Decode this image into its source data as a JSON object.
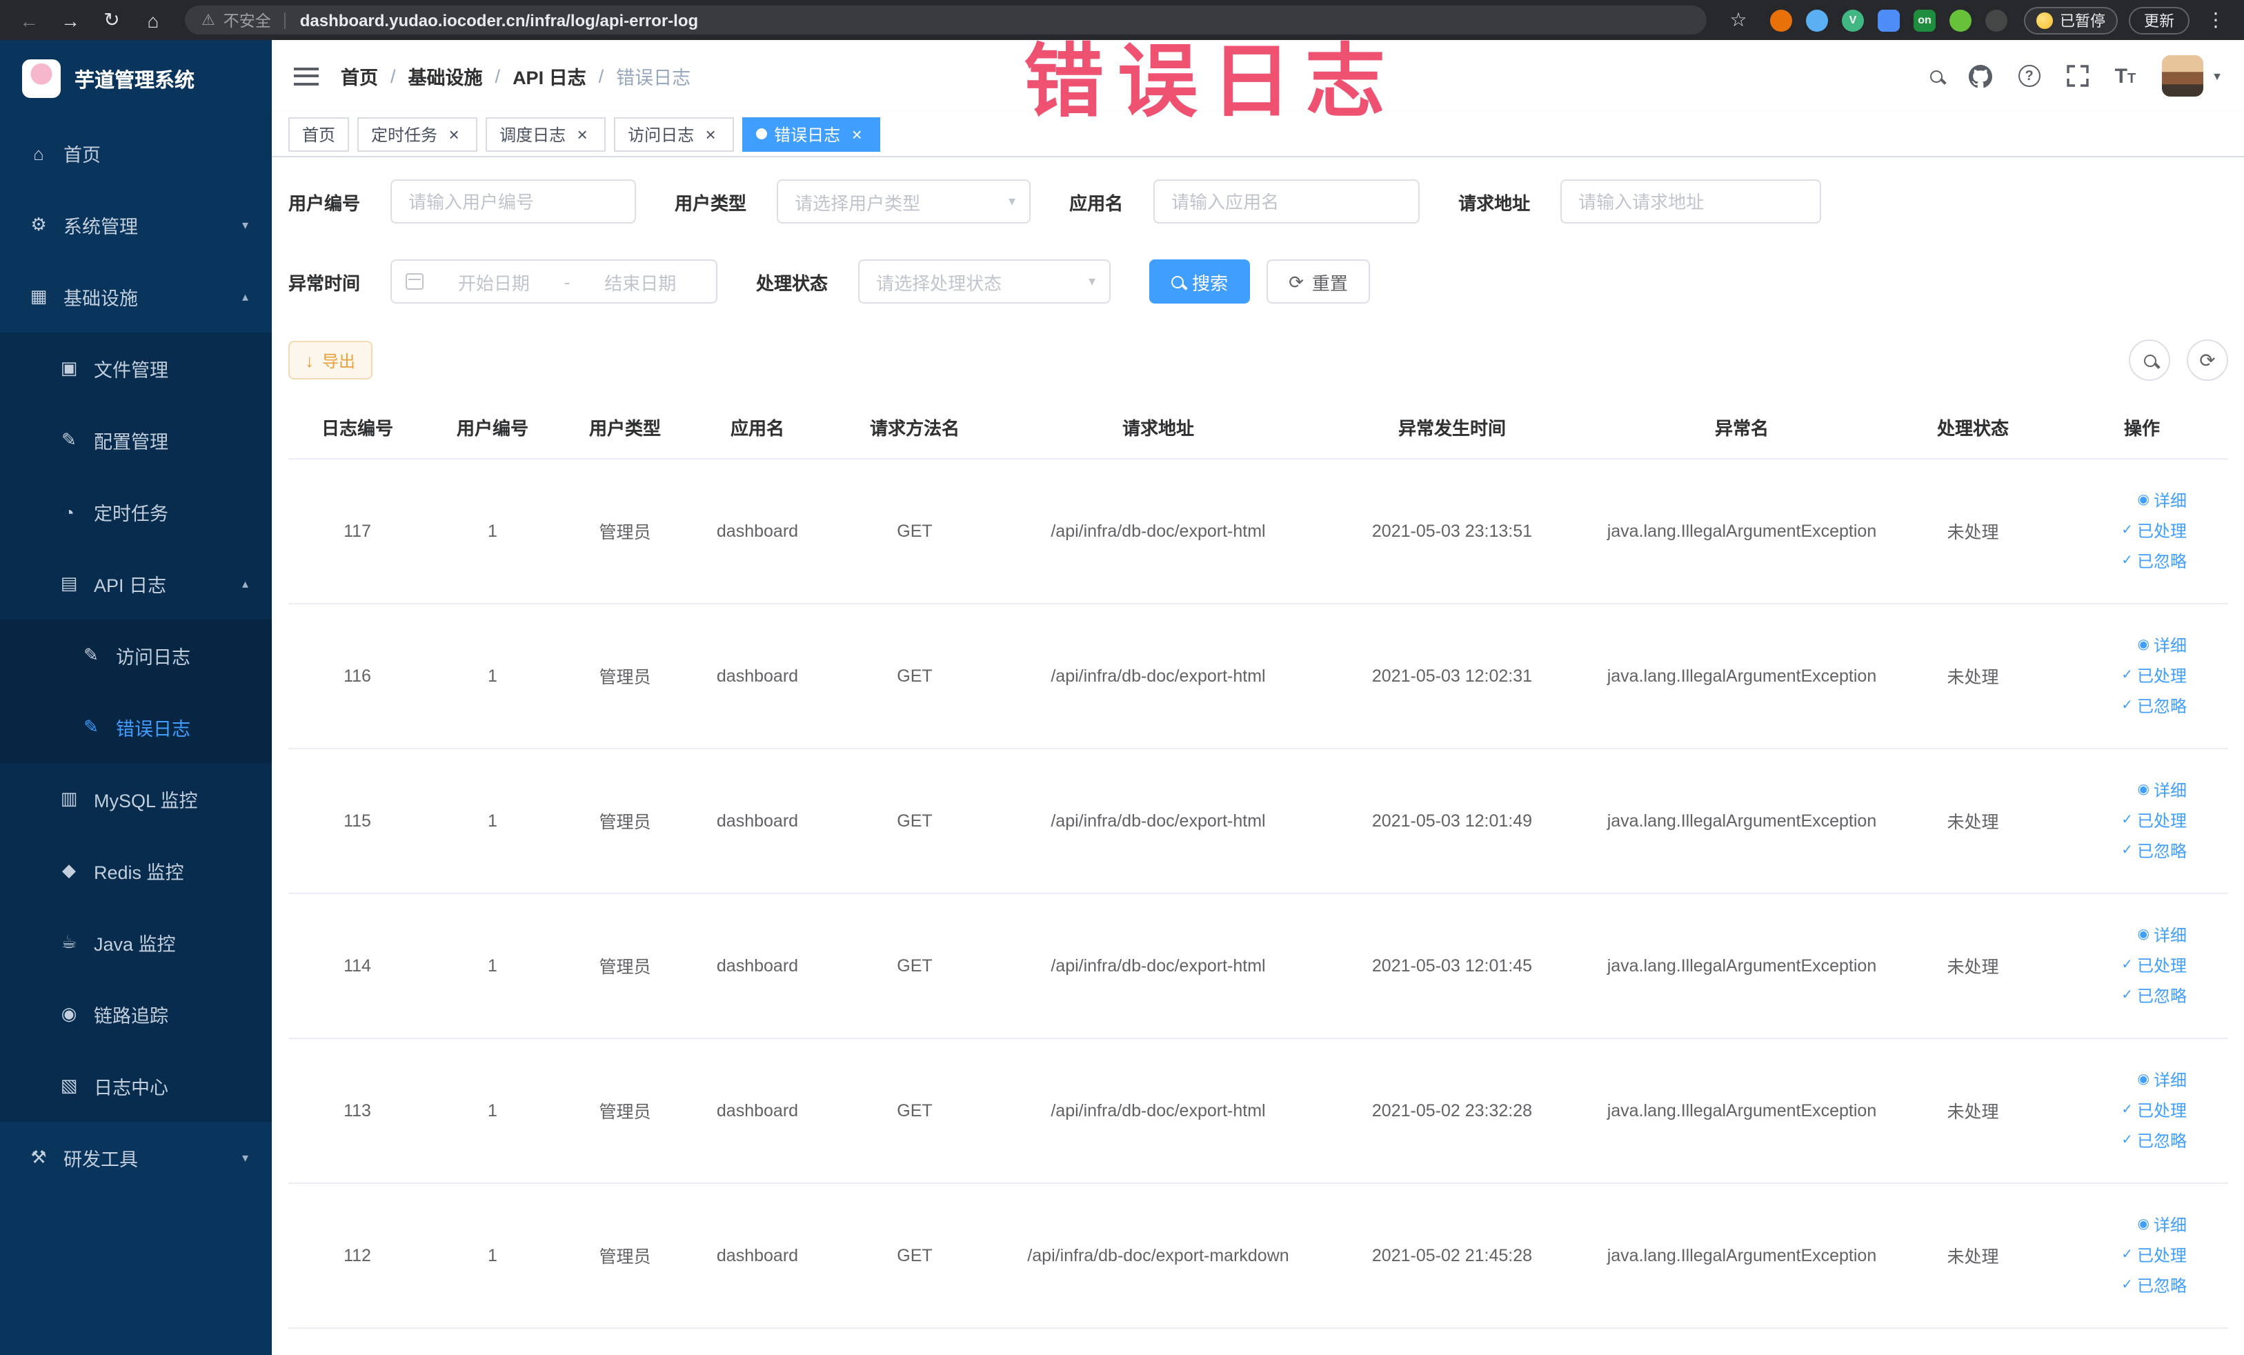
{
  "icons": {
    "back": "←",
    "forward": "→",
    "reload": "↻",
    "home": "⌂",
    "warning": "⚠",
    "star": "☆",
    "menu_dots": "⋮",
    "chevron_down": "▾",
    "chevron_up": "▴",
    "caret_down": "▼",
    "close": "×",
    "refresh": "⟳",
    "download": "↓",
    "question": "?",
    "fontsize_big": "T",
    "fontsize_small": "T"
  },
  "overlay": {
    "text": "错误日志"
  },
  "browser": {
    "security_label": "不安全",
    "url": "dashboard.yudao.iocoder.cn/infra/log/api-error-log",
    "paused_badge": "已暂停",
    "update_button": "更新",
    "extensions": [
      {
        "key": "orange",
        "color": "#e8710a",
        "shape": "circle",
        "glyph": ""
      },
      {
        "key": "blue",
        "color": "#5ab0f2",
        "shape": "circle",
        "glyph": ""
      },
      {
        "key": "vue-devtools",
        "color": "#41b883",
        "shape": "circle",
        "glyph": "V"
      },
      {
        "key": "grid",
        "color": "#4e8cf7",
        "shape": "square",
        "glyph": ""
      },
      {
        "key": "proxy-on",
        "color": "#1e8e3e",
        "shape": "square",
        "glyph": "on"
      },
      {
        "key": "green",
        "color": "#67c23a",
        "shape": "circle",
        "glyph": ""
      },
      {
        "key": "dark",
        "color": "#444746",
        "shape": "circle",
        "glyph": ""
      }
    ]
  },
  "sidebar": {
    "logo_title": "芋道管理系统",
    "items": [
      {
        "key": "home",
        "label": "首页",
        "icon": "home-icon",
        "glyph": "⌂",
        "depth": 0
      },
      {
        "key": "system",
        "label": "系统管理",
        "icon": "gear-icon",
        "glyph": "⚙",
        "depth": 0,
        "arrow": "down"
      },
      {
        "key": "infra",
        "label": "基础设施",
        "icon": "infra-icon",
        "glyph": "▦",
        "depth": 0,
        "arrow": "up"
      },
      {
        "key": "file",
        "label": "文件管理",
        "icon": "file-icon",
        "glyph": "▣",
        "depth": 1
      },
      {
        "key": "config",
        "label": "配置管理",
        "icon": "config-icon",
        "glyph": "✎",
        "depth": 1
      },
      {
        "key": "job",
        "label": "定时任务",
        "icon": "timer-icon",
        "glyph": "◔",
        "depth": 1
      },
      {
        "key": "api-log",
        "label": "API 日志",
        "icon": "api-log-icon",
        "glyph": "▤",
        "depth": 1,
        "arrow": "up"
      },
      {
        "key": "access-log",
        "label": "访问日志",
        "icon": "access-log-icon",
        "glyph": "✎",
        "depth": 2
      },
      {
        "key": "error-log",
        "label": "错误日志",
        "icon": "error-log-icon",
        "glyph": "✎",
        "depth": 2,
        "active": true
      },
      {
        "key": "mysql",
        "label": "MySQL 监控",
        "icon": "mysql-icon",
        "glyph": "▥",
        "depth": 1
      },
      {
        "key": "redis",
        "label": "Redis 监控",
        "icon": "redis-icon",
        "glyph": "◆",
        "depth": 1
      },
      {
        "key": "java",
        "label": "Java 监控",
        "icon": "java-icon",
        "glyph": "☕",
        "depth": 1
      },
      {
        "key": "trace",
        "label": "链路追踪",
        "icon": "trace-icon",
        "glyph": "◉",
        "depth": 1
      },
      {
        "key": "log-center",
        "label": "日志中心",
        "icon": "log-center-icon",
        "glyph": "▧",
        "depth": 1
      },
      {
        "key": "devtools",
        "label": "研发工具",
        "icon": "tools-icon",
        "glyph": "⚒",
        "depth": 0,
        "arrow": "down"
      }
    ]
  },
  "breadcrumb": {
    "items": [
      "首页",
      "基础设施",
      "API 日志",
      "错误日志"
    ],
    "separator": "/"
  },
  "tags": {
    "items": [
      {
        "key": "home",
        "label": "首页",
        "closable": false,
        "active": false
      },
      {
        "key": "job",
        "label": "定时任务",
        "closable": true,
        "active": false
      },
      {
        "key": "job-log",
        "label": "调度日志",
        "closable": true,
        "active": false
      },
      {
        "key": "access-log",
        "label": "访问日志",
        "closable": true,
        "active": false
      },
      {
        "key": "error-log",
        "label": "错误日志",
        "closable": true,
        "active": true
      }
    ]
  },
  "filters": {
    "user_id": {
      "label": "用户编号",
      "placeholder": "请输入用户编号"
    },
    "user_type": {
      "label": "用户类型",
      "placeholder": "请选择用户类型"
    },
    "app_name": {
      "label": "应用名",
      "placeholder": "请输入应用名"
    },
    "request_url": {
      "label": "请求地址",
      "placeholder": "请输入请求地址"
    },
    "exception_time": {
      "label": "异常时间",
      "start_placeholder": "开始日期",
      "end_placeholder": "结束日期",
      "separator": "-"
    },
    "process_status": {
      "label": "处理状态",
      "placeholder": "请选择处理状态"
    },
    "search_button": "搜索",
    "reset_button": "重置"
  },
  "toolbar": {
    "export_button": "导出"
  },
  "table": {
    "headers": [
      "日志编号",
      "用户编号",
      "用户类型",
      "应用名",
      "请求方法名",
      "请求地址",
      "异常发生时间",
      "异常名",
      "处理状态",
      "操作"
    ],
    "actions": [
      {
        "key": "detail",
        "label": "详细",
        "icon": "eye-icon",
        "glyph": "◉"
      },
      {
        "key": "processed",
        "label": "已处理",
        "icon": "check-icon",
        "glyph": "✓"
      },
      {
        "key": "ignored",
        "label": "已忽略",
        "icon": "check-icon",
        "glyph": "✓"
      }
    ],
    "rows": [
      {
        "id": "117",
        "user_id": "1",
        "user_type": "管理员",
        "app": "dashboard",
        "method": "GET",
        "url": "/api/infra/db-doc/export-html",
        "time": "2021-05-03 23:13:51",
        "exception": "java.lang.IllegalArgumentException",
        "status": "未处理"
      },
      {
        "id": "116",
        "user_id": "1",
        "user_type": "管理员",
        "app": "dashboard",
        "method": "GET",
        "url": "/api/infra/db-doc/export-html",
        "time": "2021-05-03 12:02:31",
        "exception": "java.lang.IllegalArgumentException",
        "status": "未处理"
      },
      {
        "id": "115",
        "user_id": "1",
        "user_type": "管理员",
        "app": "dashboard",
        "method": "GET",
        "url": "/api/infra/db-doc/export-html",
        "time": "2021-05-03 12:01:49",
        "exception": "java.lang.IllegalArgumentException",
        "status": "未处理"
      },
      {
        "id": "114",
        "user_id": "1",
        "user_type": "管理员",
        "app": "dashboard",
        "method": "GET",
        "url": "/api/infra/db-doc/export-html",
        "time": "2021-05-03 12:01:45",
        "exception": "java.lang.IllegalArgumentException",
        "status": "未处理"
      },
      {
        "id": "113",
        "user_id": "1",
        "user_type": "管理员",
        "app": "dashboard",
        "method": "GET",
        "url": "/api/infra/db-doc/export-html",
        "time": "2021-05-02 23:32:28",
        "exception": "java.lang.IllegalArgumentException",
        "status": "未处理"
      },
      {
        "id": "112",
        "user_id": "1",
        "user_type": "管理员",
        "app": "dashboard",
        "method": "GET",
        "url": "/api/infra/db-doc/export-markdown",
        "time": "2021-05-02 21:45:28",
        "exception": "java.lang.IllegalArgumentException",
        "status": "未处理"
      }
    ]
  }
}
